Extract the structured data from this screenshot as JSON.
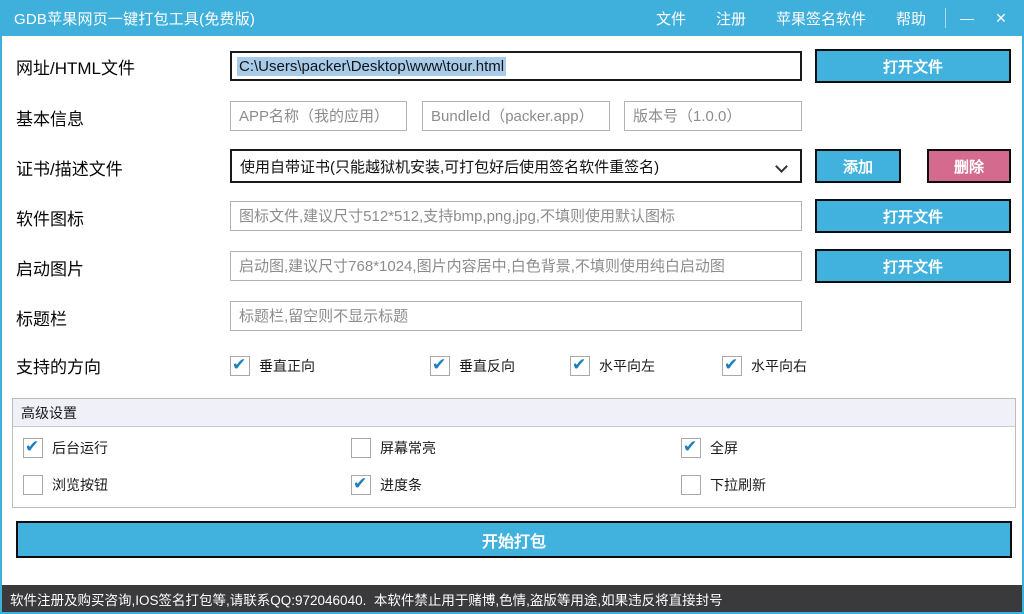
{
  "window": {
    "title": "GDB苹果网页一键打包工具(免费版)",
    "menu": [
      "文件",
      "注册",
      "苹果签名软件",
      "帮助"
    ],
    "minimize_icon": "—",
    "close_icon": "✕"
  },
  "colors": {
    "accent": "#41b1dd",
    "danger": "#d46a8e",
    "check": "#1c7ebb",
    "statusbar_bg": "#3a3a3d"
  },
  "rows": {
    "url": {
      "label": "网址/HTML文件",
      "value": "C:\\Users\\packer\\Desktop\\www\\tour.html",
      "button": "打开文件"
    },
    "basic": {
      "label": "基本信息",
      "placeholders": [
        "APP名称（我的应用）",
        "BundleId（packer.app）",
        "版本号（1.0.0）"
      ]
    },
    "cert": {
      "label": "证书/描述文件",
      "selected": "使用自带证书(只能越狱机安装,可打包好后使用签名软件重签名)",
      "add_button": "添加",
      "delete_button": "删除"
    },
    "icon": {
      "label": "软件图标",
      "placeholder": "图标文件,建议尺寸512*512,支持bmp,png,jpg,不填则使用默认图标",
      "button": "打开文件"
    },
    "launch": {
      "label": "启动图片",
      "placeholder": "启动图,建议尺寸768*1024,图片内容居中,白色背景,不填则使用纯白启动图",
      "button": "打开文件"
    },
    "title_field": {
      "label": "标题栏",
      "placeholder": "标题栏,留空则不显示标题"
    },
    "orientation": {
      "label": "支持的方向",
      "options": [
        {
          "label": "垂直正向",
          "checked": true
        },
        {
          "label": "垂直反向",
          "checked": true
        },
        {
          "label": "水平向左",
          "checked": true
        },
        {
          "label": "水平向右",
          "checked": true
        }
      ]
    }
  },
  "advanced": {
    "title": "高级设置",
    "options": [
      {
        "label": "后台运行",
        "checked": true
      },
      {
        "label": "屏幕常亮",
        "checked": false
      },
      {
        "label": "全屏",
        "checked": true
      },
      {
        "label": "浏览按钮",
        "checked": false
      },
      {
        "label": "进度条",
        "checked": true
      },
      {
        "label": "下拉刷新",
        "checked": false
      }
    ]
  },
  "pack_button": "开始打包",
  "statusbar": "软件注册及购买咨询,IOS签名打包等,请联系QQ:972046040.  本软件禁止用于赌博,色情,盗版等用途,如果违反将直接封号"
}
